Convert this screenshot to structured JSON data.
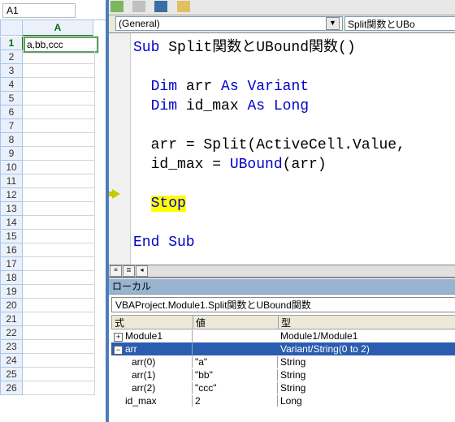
{
  "nameBox": "A1",
  "excel": {
    "colHeader": "A",
    "rows": [
      "1",
      "2",
      "3",
      "4",
      "5",
      "6",
      "7",
      "8",
      "9",
      "10",
      "11",
      "12",
      "13",
      "14",
      "15",
      "16",
      "17",
      "18",
      "19",
      "20",
      "21",
      "22",
      "23",
      "24",
      "25",
      "26"
    ],
    "activeCell": "a,bb,ccc"
  },
  "vbe": {
    "objectCombo": "(General)",
    "procCombo": "Split関数とUBo",
    "code": {
      "sub_kw": "Sub",
      "sub_name": " Split関数とUBound関数()",
      "dim_arr_l": "Dim ",
      "dim_arr_m": "arr ",
      "dim_arr_r": "As Variant",
      "dim_id_l": "Dim ",
      "dim_id_m": "id_max ",
      "dim_id_r": "As Long",
      "assign1_l": "arr = Split(ActiveCell.Value, ",
      "assign2_l": "id_max = ",
      "ubound": "UBound",
      "assign2_r": "(arr)",
      "stop": "Stop",
      "end": "End Sub"
    },
    "localsTitle": "ローカル",
    "context": "VBAProject.Module1.Split関数とUBound関数",
    "hdr_expr": "式",
    "hdr_val": "値",
    "hdr_type": "型",
    "vars": {
      "module_name": "Module1",
      "module_type": "Module1/Module1",
      "arr_name": "arr",
      "arr_type": "Variant/String(0 to 2)",
      "arr0_name": "arr(0)",
      "arr0_val": "\"a\"",
      "arr0_type": "String",
      "arr1_name": "arr(1)",
      "arr1_val": "\"bb\"",
      "arr1_type": "String",
      "arr2_name": "arr(2)",
      "arr2_val": "\"ccc\"",
      "arr2_type": "String",
      "id_name": "id_max",
      "id_val": "2",
      "id_type": "Long"
    }
  }
}
